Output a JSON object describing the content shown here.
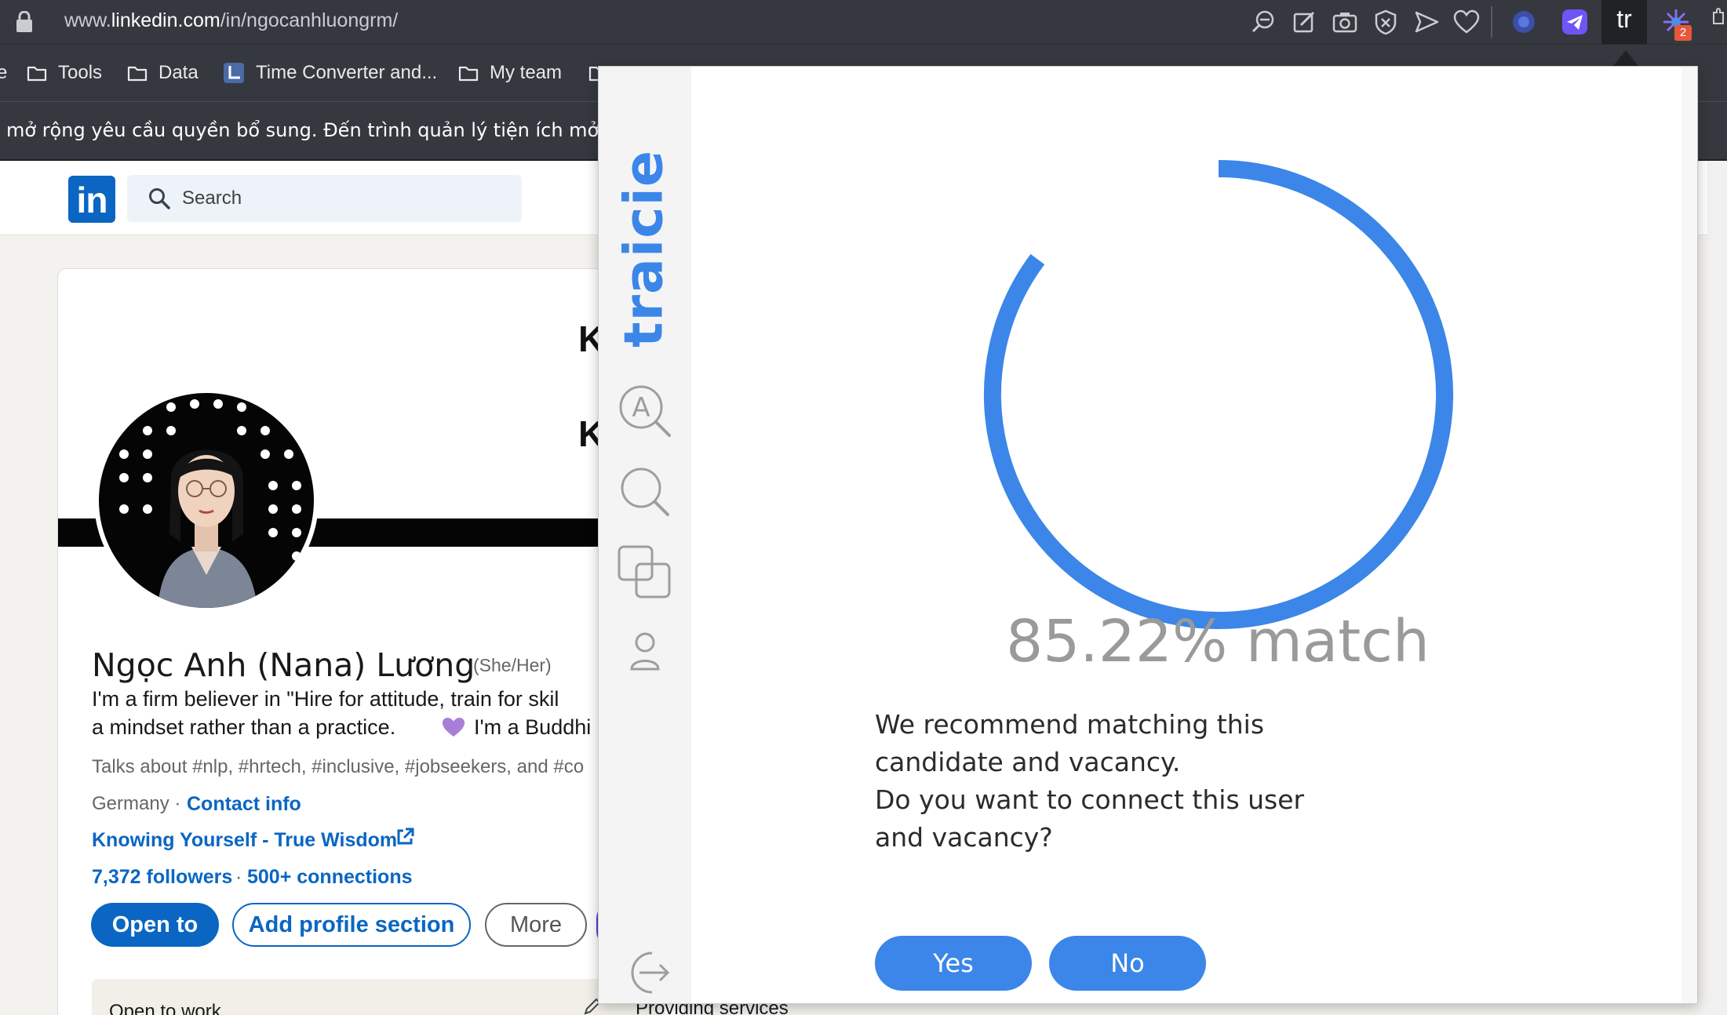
{
  "browser": {
    "url_prefix": "www.",
    "url_domain": "linkedin.com",
    "url_path": "/in/ngocanhluongrm/",
    "extension_tr_label": "tr",
    "extension_badge": "2",
    "bookmarks": [
      {
        "label": "e",
        "icon": "folder-icon"
      },
      {
        "label": "Tools",
        "icon": "folder-icon"
      },
      {
        "label": "Data",
        "icon": "folder-icon"
      },
      {
        "label": "Time Converter and...",
        "icon": "time-converter-icon"
      },
      {
        "label": "My team",
        "icon": "folder-icon"
      }
    ],
    "infobar_text": "mở rộng yêu cầu quyền bổ sung. Đến trình quản lý tiện ích mở rộng để"
  },
  "linkedin": {
    "logo_text": "in",
    "search_placeholder": "Search",
    "banner_text_1": "K",
    "banner_text_2": "K",
    "profile": {
      "name": "Ngọc Anh (Nana) Lương",
      "pronouns": "(She/Her)",
      "headline_line1": "I'm a firm believer in \"Hire for attitude, train for skil",
      "headline_line2": "a mindset rather than a practice.",
      "headline_line2b": "I'm a Buddhi",
      "talks_about": "Talks about #nlp, #hrtech, #inclusive, #jobseekers, and #co",
      "location": "Germany ·",
      "contact_info": "Contact info",
      "website": "Knowing Yourself - True Wisdom",
      "followers": "7,372 followers",
      "connections_sep": "·",
      "connections": "500+ connections"
    },
    "buttons": {
      "open_to": "Open to",
      "add_profile_section": "Add profile section",
      "more": "More"
    },
    "open_to_work_label": "Open to work",
    "providing_services_label": "Providing services"
  },
  "traicie": {
    "logo_text": "traicie",
    "match_percent": 85.22,
    "match_text": "85.22% match",
    "recommendation_line1": "We recommend matching this candidate and vacancy.",
    "recommendation_line2": "Do you want to connect this user and vacancy?",
    "yes_label": "Yes",
    "no_label": "No",
    "accent_color": "#3b86e8",
    "sidebar_icons": [
      "analyze-icon",
      "search-icon",
      "compare-icon",
      "user-icon",
      "logout-icon"
    ]
  }
}
